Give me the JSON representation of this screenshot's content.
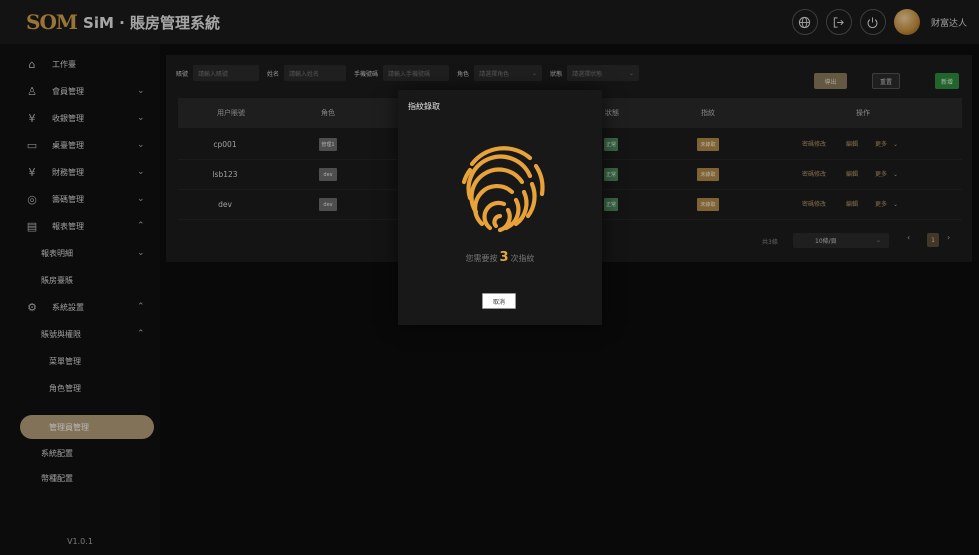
{
  "header": {
    "logo_mark": "SOM",
    "title": "SiM · 賬房管理系統",
    "icons": [
      "globe-icon",
      "logout-icon",
      "power-icon"
    ],
    "user": "财富达人"
  },
  "sidebar": {
    "items": [
      {
        "label": "工作臺",
        "icon": "home-icon"
      },
      {
        "label": "會員管理",
        "icon": "members-icon",
        "chevron": "⌄"
      },
      {
        "label": "收銀管理",
        "icon": "cashier-icon",
        "chevron": "⌄"
      },
      {
        "label": "桌臺管理",
        "icon": "table-icon",
        "chevron": "⌄"
      },
      {
        "label": "財務管理",
        "icon": "finance-icon",
        "chevron": "⌄"
      },
      {
        "label": "籌碼管理",
        "icon": "chip-icon",
        "chevron": "⌄"
      },
      {
        "label": "報表管理",
        "icon": "report-icon",
        "chevron": "⌃"
      },
      {
        "label": "報表明細",
        "chevron": "⌄"
      },
      {
        "label": "賬房臺賬"
      },
      {
        "label": "系統設置",
        "icon": "settings-icon",
        "chevron": "⌃"
      },
      {
        "label": "賬號與權限",
        "chevron": "⌃"
      },
      {
        "label": "菜單管理"
      },
      {
        "label": "角色管理"
      },
      {
        "label": "管理員管理"
      },
      {
        "label": "系統配置"
      },
      {
        "label": "幣種配置"
      }
    ],
    "version": "V1.0.1"
  },
  "filters": [
    {
      "label": "賬號",
      "placeholder": "請輸入賬號"
    },
    {
      "label": "姓名",
      "placeholder": "請輸入姓名"
    },
    {
      "label": "手機號碼",
      "placeholder": "請輸入手機號碼"
    },
    {
      "label": "角色",
      "placeholder": "請選擇角色"
    },
    {
      "label": "狀態",
      "placeholder": "請選擇狀態"
    }
  ],
  "buttons": {
    "export": "導出",
    "reset": "重置",
    "add": "新增"
  },
  "table": {
    "headers": [
      "用户賬號",
      "角色",
      "狀態",
      "指紋",
      "操作"
    ],
    "rows": [
      {
        "account": "cp001",
        "role": "管理1",
        "status": "正常",
        "fingerprint": "未錄取"
      },
      {
        "account": "lsb123",
        "role": "dev",
        "status": "正常",
        "fingerprint": "未錄取"
      },
      {
        "account": "dev",
        "role": "dev",
        "status": "正常",
        "fingerprint": "未錄取"
      }
    ],
    "ops": {
      "password": "密碼修改",
      "edit": "編輯",
      "more": "更多"
    }
  },
  "pagination": {
    "total": "共3條",
    "page_size": "10條/頁",
    "current": "1",
    "prev": "‹",
    "next": "›"
  },
  "modal": {
    "title": "指紋錄取",
    "text_before": "您需要按",
    "count": "3",
    "text_after": "次指紋",
    "cancel": "取消",
    "icon": "fingerprint-icon",
    "accent": "#E8A23A"
  }
}
